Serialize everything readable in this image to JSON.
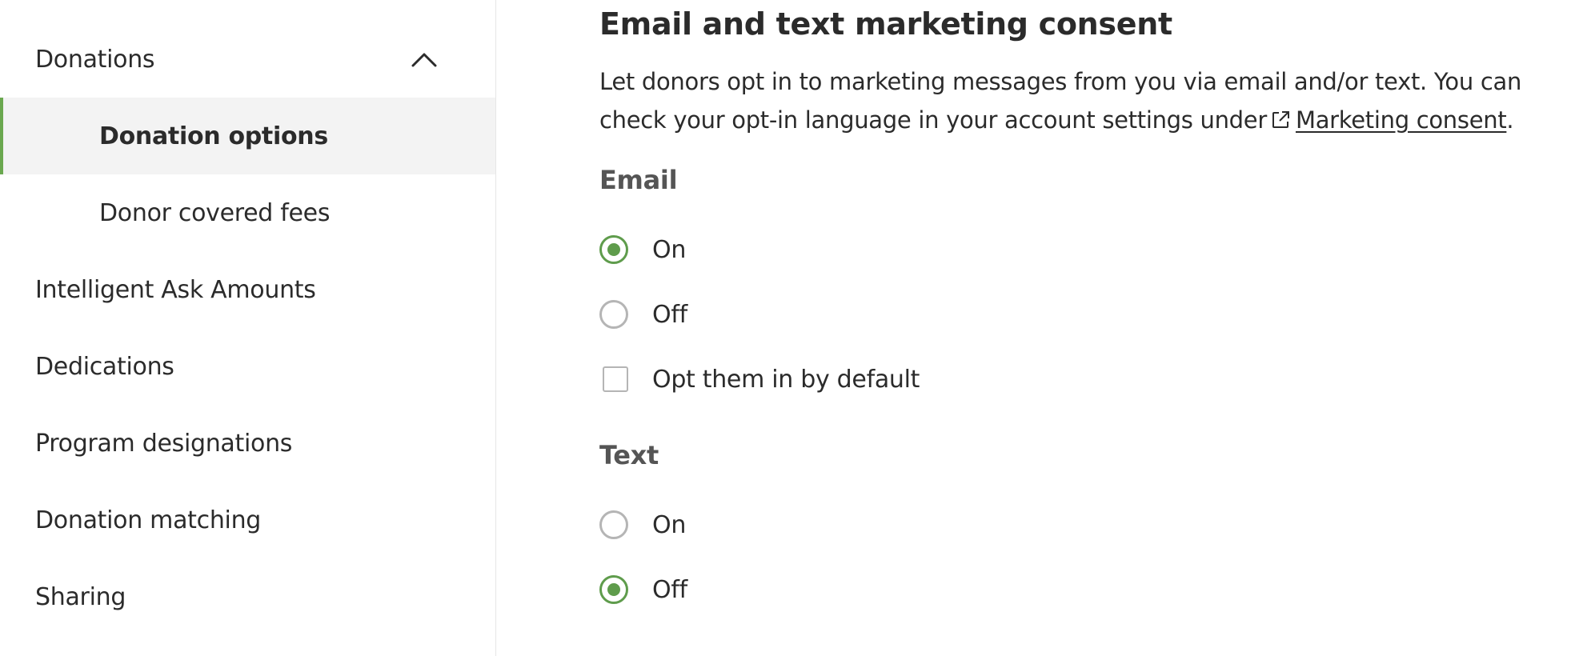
{
  "sidebar": {
    "items": [
      {
        "label": "Donations",
        "expanded": true
      },
      {
        "label": "Donation options",
        "active": true,
        "sub": true
      },
      {
        "label": "Donor covered fees",
        "sub": true
      },
      {
        "label": "Intelligent Ask Amounts"
      },
      {
        "label": "Dedications"
      },
      {
        "label": "Program designations"
      },
      {
        "label": "Donation matching"
      },
      {
        "label": "Sharing"
      }
    ]
  },
  "main": {
    "title": "Email and text marketing consent",
    "description_part1": "Let donors opt in to marketing messages from you via email and/or text. You can check your opt-in language in your account settings under",
    "link_label": "Marketing consent",
    "description_end": ".",
    "email": {
      "label": "Email",
      "on_label": "On",
      "off_label": "Off",
      "selected": "On",
      "default_checkbox_label": "Opt them in by default",
      "default_checked": false
    },
    "text": {
      "label": "Text",
      "on_label": "On",
      "off_label": "Off",
      "selected": "Off"
    }
  },
  "colors": {
    "accent": "#5f9c4c",
    "active_bg": "#f3f3f3",
    "border": "#e6e6e6"
  }
}
